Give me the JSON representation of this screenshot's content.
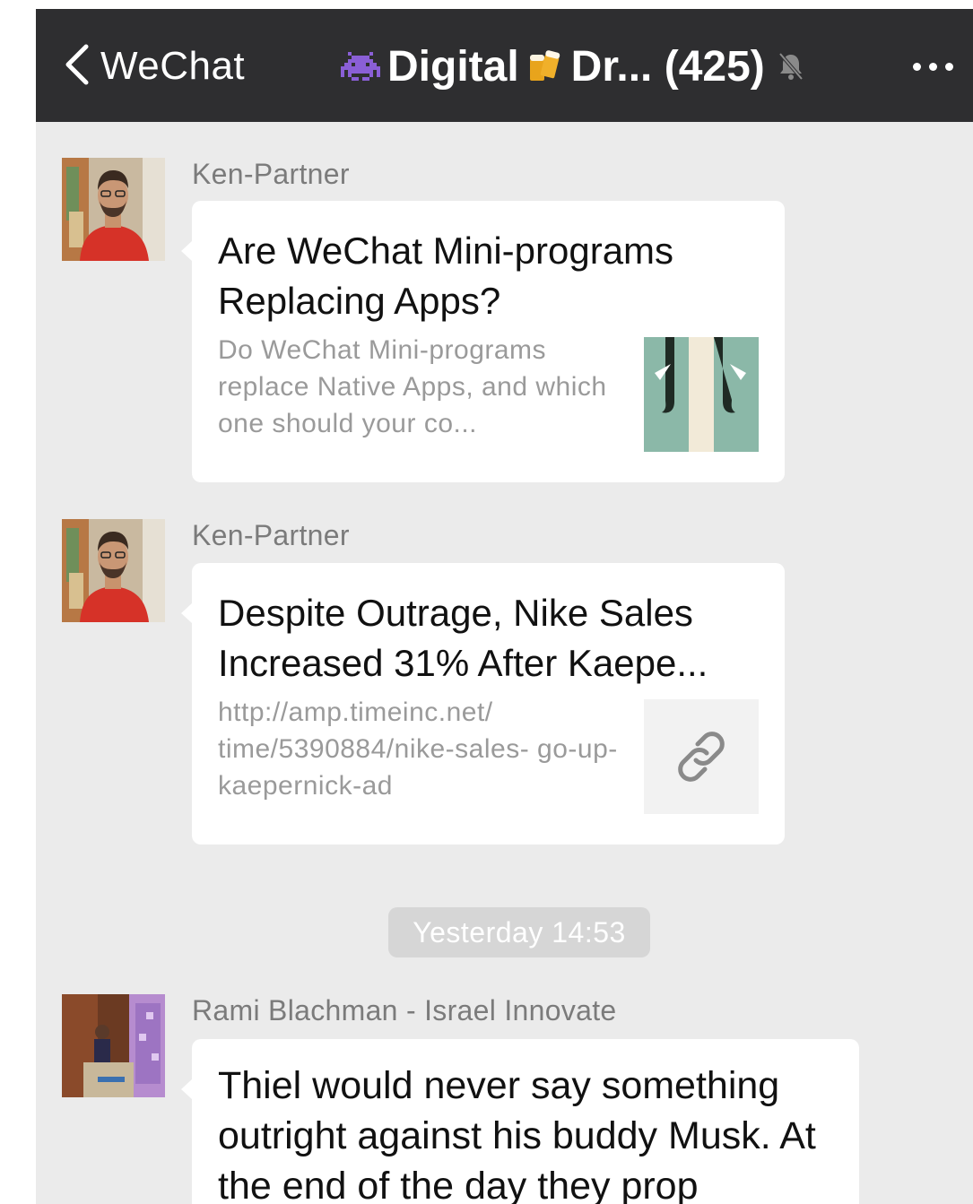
{
  "header": {
    "back_label": "WeChat",
    "title_part1": "Digital",
    "title_part2": "Dr... (425)",
    "icons": [
      "back-chevron-icon",
      "alien-monster-icon",
      "beer-mugs-icon",
      "mute-bell-icon",
      "more-dots-icon"
    ]
  },
  "messages": [
    {
      "sender": "Ken-Partner",
      "type": "link-card",
      "title": "Are WeChat Mini-programs Replacing Apps?",
      "description": "Do WeChat Mini-programs replace Native Apps, and which one should your co...",
      "thumbnail": "article-illustration"
    },
    {
      "sender": "Ken-Partner",
      "type": "link-card",
      "title": "Despite Outrage, Nike Sales Increased 31% After Kaepe...",
      "description": "http://amp.timeinc.net/ time/5390884/nike-sales- go-up-kaepernick-ad",
      "thumbnail": "link-icon"
    },
    {
      "sender": "Rami Blachman - Israel Innovate",
      "type": "text",
      "text": "Thiel would never say something outright against his buddy Musk. At the end of the day they prop"
    }
  ],
  "timestamp": "Yesterday 14:53",
  "colors": {
    "topbar": "#2e2e30",
    "chat_background": "#ebebeb",
    "bubble": "#ffffff",
    "timestamp_pill": "#d6d6d6"
  }
}
